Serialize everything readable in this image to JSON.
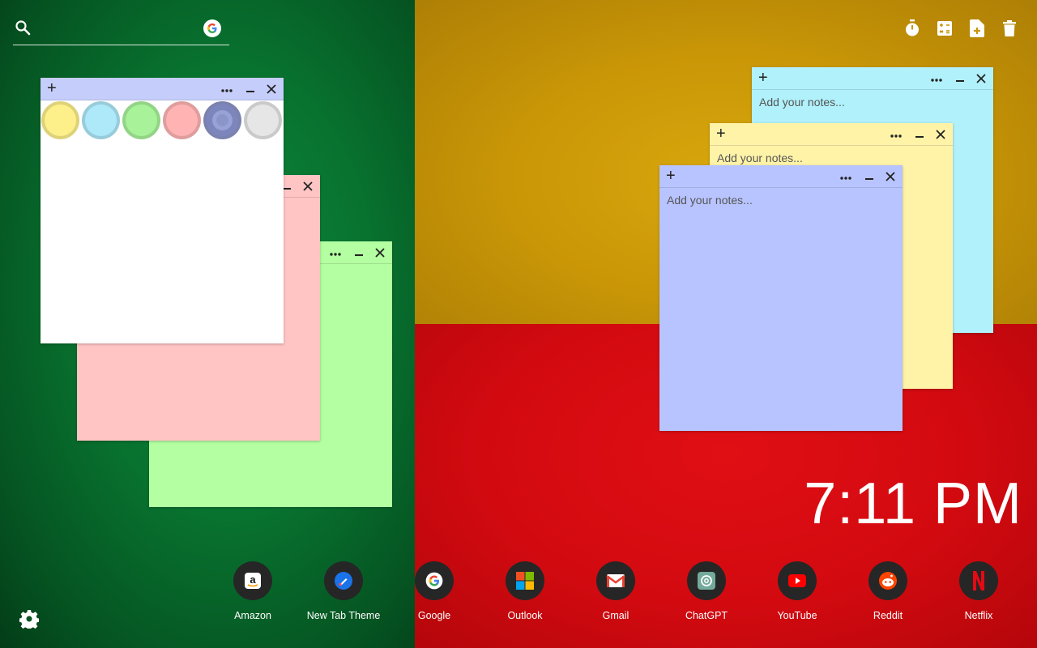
{
  "search": {
    "placeholder": "",
    "value": ""
  },
  "toolbar": {
    "icons": [
      "timer-icon",
      "calculator-icon",
      "add-file-icon",
      "trash-icon"
    ]
  },
  "notes": {
    "placeholder": "Add your notes...",
    "add_symbol": "+",
    "colors": {
      "white": "#ffffff",
      "pink": "#ffc4c4",
      "green": "#b3ffa1",
      "cyan": "#b0f1fb",
      "yellow": "#fff3a8",
      "lavender": "#b8c4ff",
      "toolbar_lavender": "#c5cdfb"
    }
  },
  "swatches": [
    "#fdf08a",
    "#aee9fa",
    "#a8f29a",
    "#ffb3b3",
    "#8c95c9",
    "#e6e6e6"
  ],
  "clock": {
    "time": "7:11 PM"
  },
  "shortcuts": [
    {
      "label": "Amazon",
      "icon": "amazon-icon"
    },
    {
      "label": "New Tab Theme",
      "icon": "new-tab-theme-icon"
    },
    {
      "label": "Google",
      "icon": "google-icon"
    },
    {
      "label": "Outlook",
      "icon": "microsoft-icon"
    },
    {
      "label": "Gmail",
      "icon": "gmail-icon"
    },
    {
      "label": "ChatGPT",
      "icon": "chatgpt-icon"
    },
    {
      "label": "YouTube",
      "icon": "youtube-icon"
    },
    {
      "label": "Reddit",
      "icon": "reddit-icon"
    },
    {
      "label": "Netflix",
      "icon": "netflix-icon"
    }
  ],
  "background": {
    "left": "#08722f",
    "right_top": "#c99607",
    "right_bottom": "#d20a10"
  }
}
